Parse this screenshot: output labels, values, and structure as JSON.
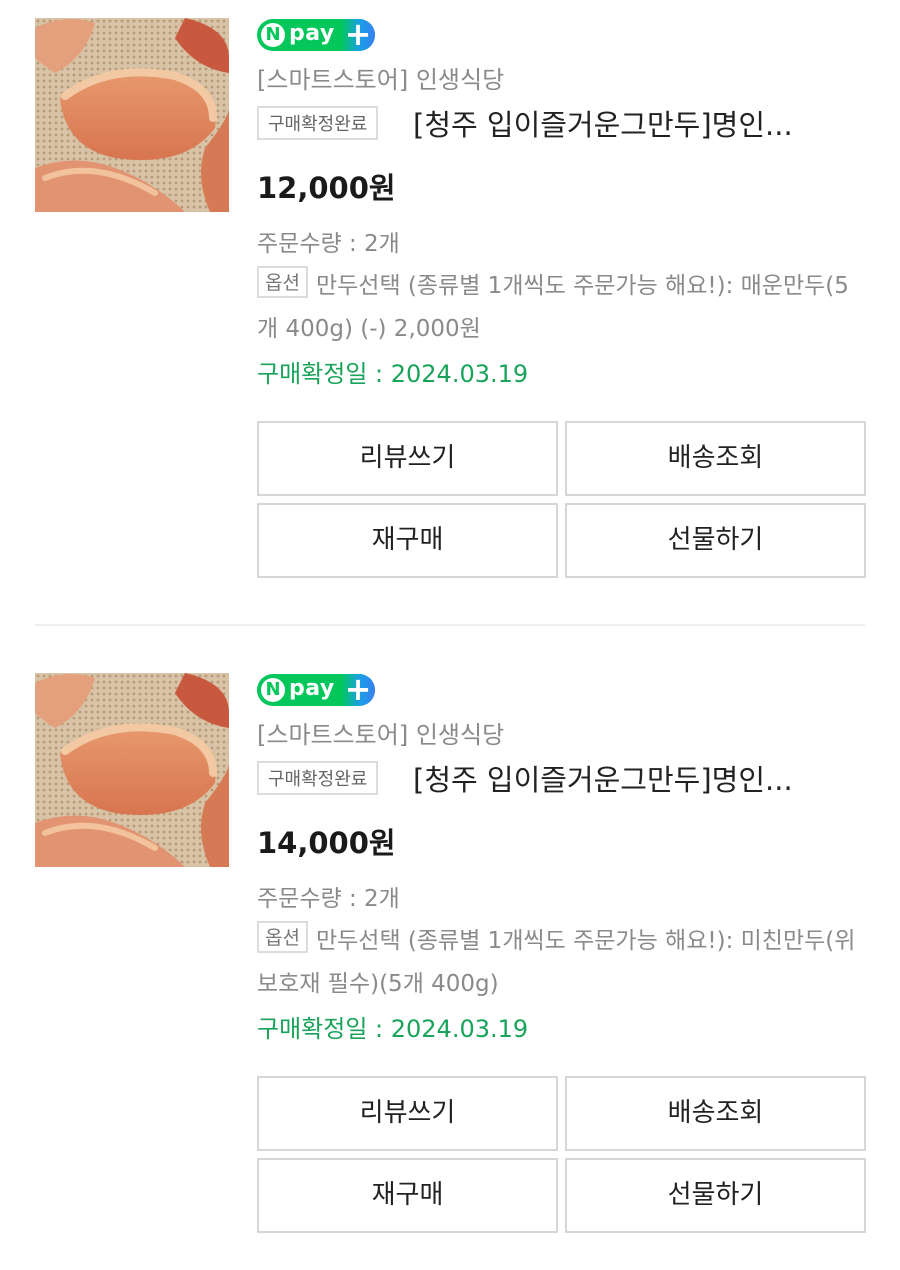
{
  "orders": [
    {
      "npay_text": "pay",
      "npay_n": "N",
      "npay_plus": "+",
      "store": "[스마트스토어] 인생식당",
      "status_badge": "구매확정완료",
      "title": "[청주 입이즐거운그만두]명인...",
      "price": "12,000원",
      "quantity": "주문수량 : 2개",
      "option_badge": "옵션",
      "option_text": "만두선택 (종류별 1개씩도 주문가능 해요!): 매운만두(5개 400g) (-) 2,000원",
      "confirm_date": "구매확정일 : 2024.03.19",
      "buttons": {
        "review": "리뷰쓰기",
        "shipping": "배송조회",
        "rebuy": "재구매",
        "gift": "선물하기"
      }
    },
    {
      "npay_text": "pay",
      "npay_n": "N",
      "npay_plus": "+",
      "store": "[스마트스토어] 인생식당",
      "status_badge": "구매확정완료",
      "title": "[청주 입이즐거운그만두]명인...",
      "price": "14,000원",
      "quantity": "주문수량 : 2개",
      "option_badge": "옵션",
      "option_text": "만두선택 (종류별 1개씩도 주문가능 해요!): 미친만두(위보호재 필수)(5개 400g)",
      "confirm_date": "구매확정일 : 2024.03.19",
      "buttons": {
        "review": "리뷰쓰기",
        "shipping": "배송조회",
        "rebuy": "재구매",
        "gift": "선물하기"
      }
    }
  ],
  "colors": {
    "npay_green": "#03c75a",
    "confirm_green": "#1aa35a",
    "muted_text": "#8a8a8a",
    "border": "#d6d6d6"
  },
  "icons": {
    "thumbnail": "dumpling-product-image",
    "npay": "npay-plus-logo"
  }
}
